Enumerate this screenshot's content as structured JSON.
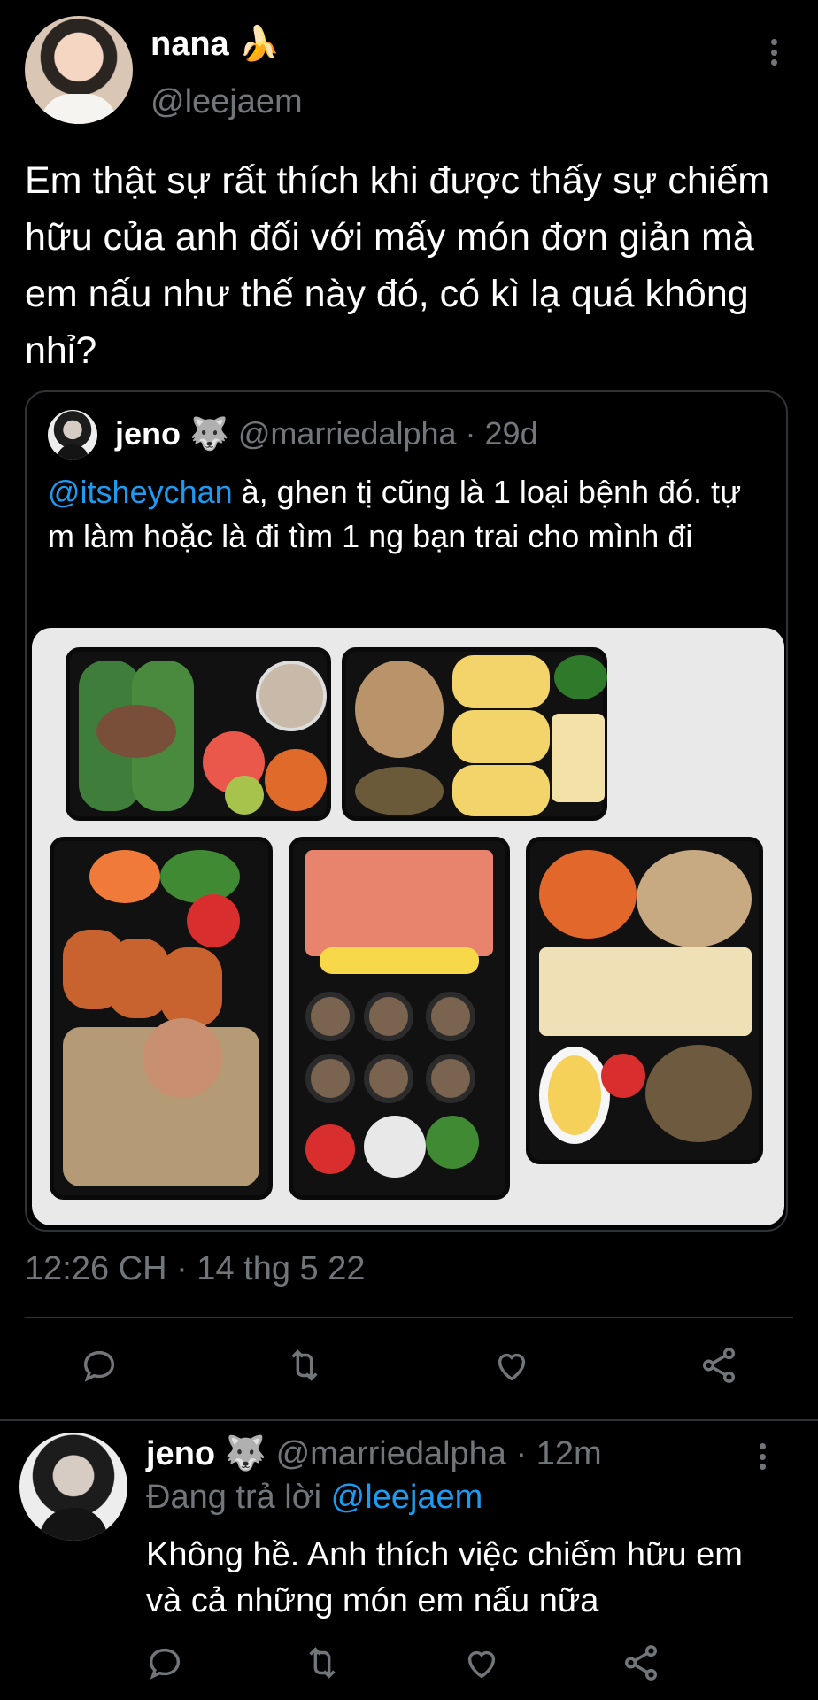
{
  "main_tweet": {
    "display_name": "nana",
    "name_emoji": "🍌",
    "handle": "@leejaem",
    "text": "Em thật sự rất thích khi được thấy sự chiếm hữu của anh đối với mấy món đơn giản mà em nấu như thế này đó, có kì lạ quá không nhỉ?",
    "timestamp": "12:26 CH · 14 thg 5 22"
  },
  "quoted_tweet": {
    "display_name": "jeno",
    "name_emoji": "🐺",
    "handle": "@marriedalpha",
    "time": "· 29d",
    "mention": "@itsheychan",
    "text": " à, ghen tị cũng là 1 loại bệnh đó. tự m làm hoặc là đi tìm 1 ng bạn trai cho mình đi"
  },
  "reply_tweet": {
    "display_name": "jeno",
    "name_emoji": "🐺",
    "handle": "@marriedalpha",
    "time": "· 12m",
    "replying_prefix": "Đang trả lời ",
    "replying_handle": "@leejaem",
    "text": "Không hề. Anh thích việc chiếm hữu em và cả những món em nấu nữa"
  },
  "icons": [
    "reply-icon",
    "retweet-icon",
    "like-icon",
    "share-icon",
    "more-icon"
  ],
  "colors": {
    "background": "#000000",
    "link": "#1d9bf0",
    "muted": "#71767b"
  }
}
